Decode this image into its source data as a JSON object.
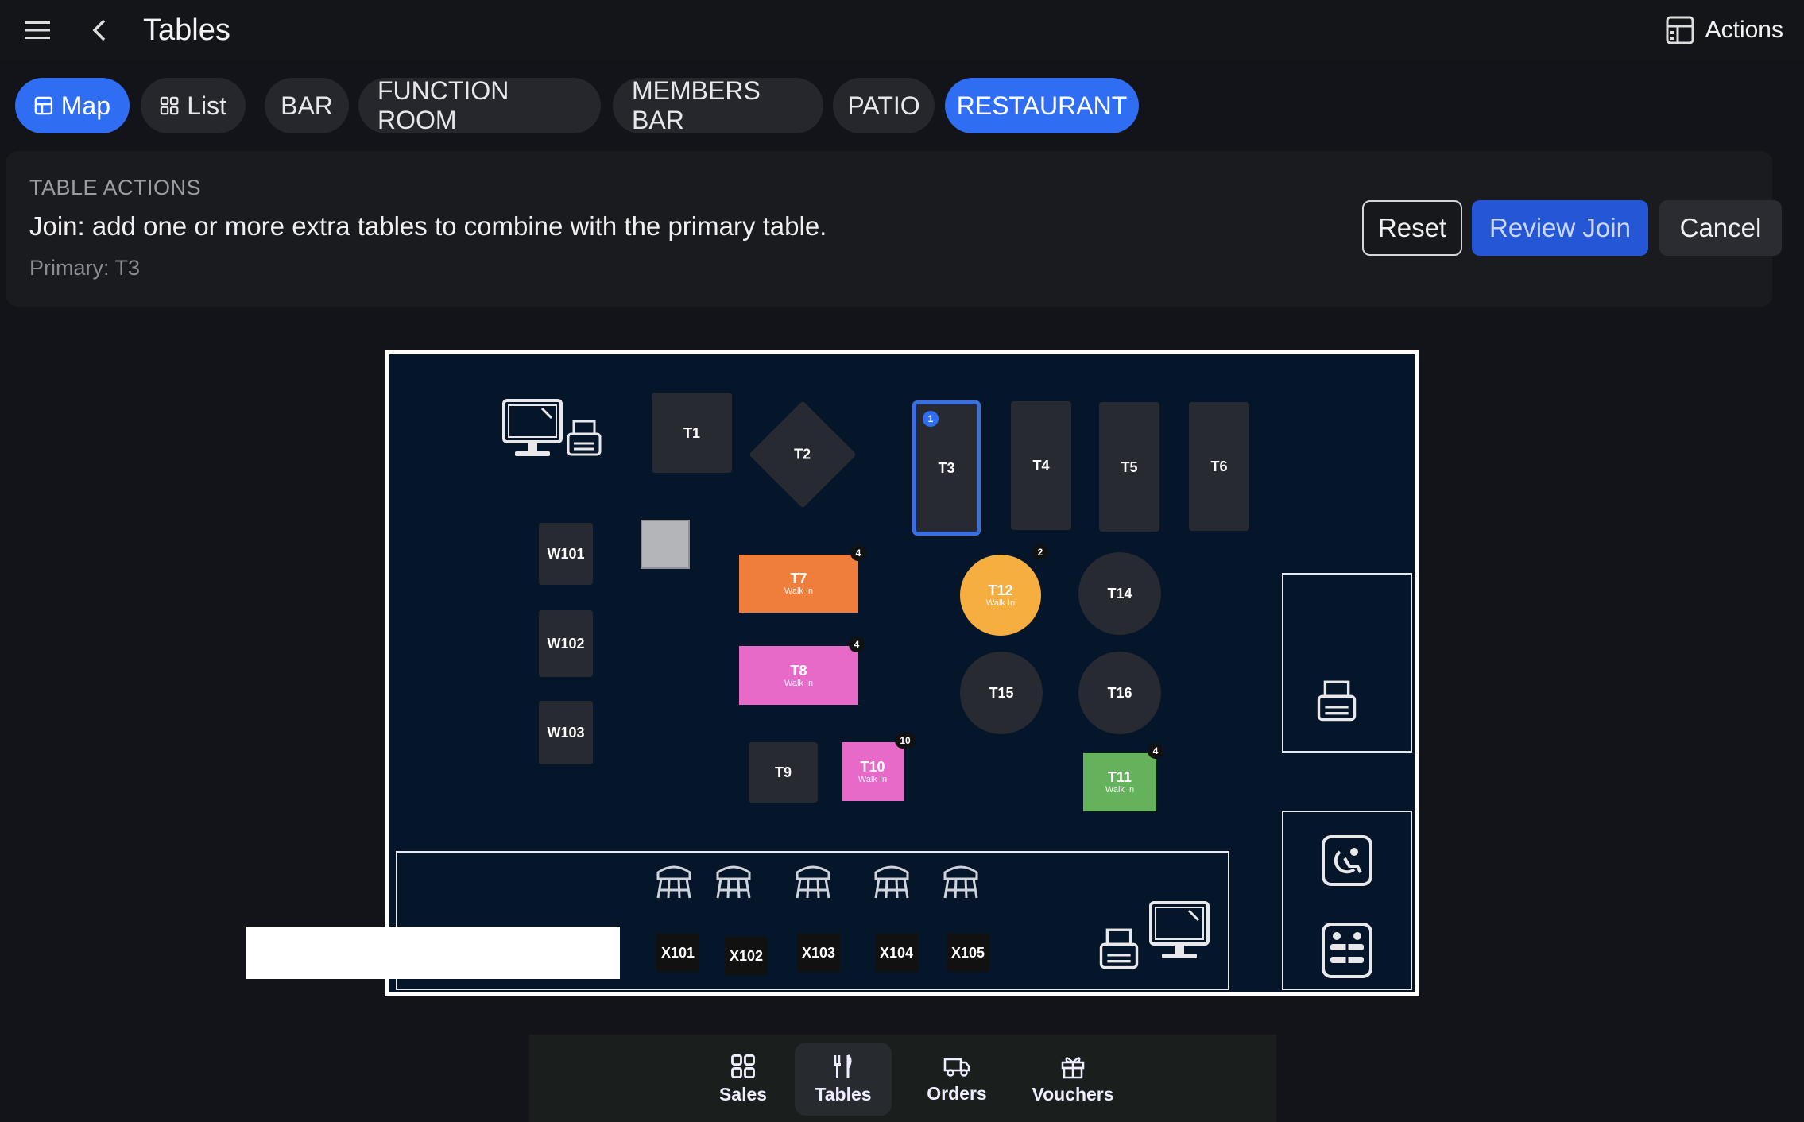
{
  "header": {
    "title": "Tables",
    "actions_label": "Actions"
  },
  "tabs": [
    {
      "label": "Map",
      "icon": "map-icon",
      "active": true
    },
    {
      "label": "List",
      "icon": "grid-icon",
      "active": false
    },
    {
      "label": "BAR",
      "active": false
    },
    {
      "label": "FUNCTION ROOM",
      "active": false
    },
    {
      "label": "MEMBERS BAR",
      "active": false
    },
    {
      "label": "PATIO",
      "active": false
    },
    {
      "label": "RESTAURANT",
      "active": true
    }
  ],
  "table_actions": {
    "label": "TABLE ACTIONS",
    "description": "Join: add one or more extra tables to combine with the primary table.",
    "primary": "Primary: T3",
    "reset_label": "Reset",
    "review_label": "Review Join",
    "cancel_label": "Cancel"
  },
  "tables": {
    "T1": {
      "name": "T1"
    },
    "T2": {
      "name": "T2"
    },
    "T3": {
      "name": "T3",
      "badge": "1",
      "selected": true
    },
    "T4": {
      "name": "T4"
    },
    "T5": {
      "name": "T5"
    },
    "T6": {
      "name": "T6"
    },
    "T7": {
      "name": "T7",
      "status": "Walk In",
      "badge": "4",
      "color": "#ef7d3b"
    },
    "T8": {
      "name": "T8",
      "status": "Walk In",
      "badge": "4",
      "color": "#e86ac8"
    },
    "T9": {
      "name": "T9"
    },
    "T10": {
      "name": "T10",
      "status": "Walk In",
      "badge": "10",
      "color": "#e86ac8"
    },
    "T11": {
      "name": "T11",
      "status": "Walk In",
      "badge": "4",
      "color": "#64b25c"
    },
    "T12": {
      "name": "T12",
      "status": "Walk In",
      "badge": "2",
      "color": "#f5ae3f"
    },
    "T14": {
      "name": "T14"
    },
    "T15": {
      "name": "T15"
    },
    "T16": {
      "name": "T16"
    },
    "W101": {
      "name": "W101"
    },
    "W102": {
      "name": "W102"
    },
    "W103": {
      "name": "W103"
    },
    "X101": {
      "name": "X101"
    },
    "X102": {
      "name": "X102"
    },
    "X103": {
      "name": "X103"
    },
    "X104": {
      "name": "X104"
    },
    "X105": {
      "name": "X105"
    }
  },
  "bottom_nav": [
    {
      "label": "Sales",
      "icon": "grid-icon"
    },
    {
      "label": "Tables",
      "icon": "cutlery-icon",
      "active": true
    },
    {
      "label": "Orders",
      "icon": "truck-icon"
    },
    {
      "label": "Vouchers",
      "icon": "gift-icon"
    }
  ],
  "colors": {
    "accent": "#2f6df3",
    "selected_border": "#3b6fe0",
    "map_bg": "#06162a"
  }
}
